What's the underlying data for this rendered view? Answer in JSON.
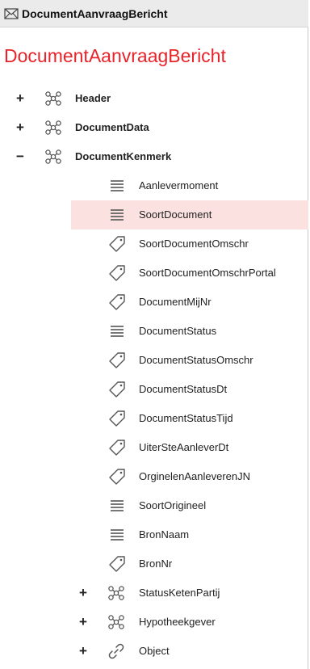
{
  "window": {
    "title": "DocumentAanvraagBericht"
  },
  "heading": "DocumentAanvraagBericht",
  "tree": {
    "top_level": [
      {
        "label": "Header",
        "expander": "+",
        "icon": "network-icon"
      },
      {
        "label": "DocumentData",
        "expander": "+",
        "icon": "network-icon"
      },
      {
        "label": "DocumentKenmerk",
        "expander": "−",
        "icon": "network-icon"
      }
    ],
    "children": [
      {
        "label": "Aanlevermoment",
        "icon": "lines-icon"
      },
      {
        "label": "SoortDocument",
        "icon": "lines-icon",
        "selected": true
      },
      {
        "label": "SoortDocumentOmschr",
        "icon": "tag-icon"
      },
      {
        "label": "SoortDocumentOmschrPortal",
        "icon": "tag-icon"
      },
      {
        "label": "DocumentMijNr",
        "icon": "tag-icon"
      },
      {
        "label": "DocumentStatus",
        "icon": "lines-icon"
      },
      {
        "label": "DocumentStatusOmschr",
        "icon": "tag-icon"
      },
      {
        "label": "DocumentStatusDt",
        "icon": "tag-icon"
      },
      {
        "label": "DocumentStatusTijd",
        "icon": "tag-icon"
      },
      {
        "label": "UiterSteAanleverDt",
        "icon": "tag-icon"
      },
      {
        "label": "OrginelenAanleverenJN",
        "icon": "tag-icon"
      },
      {
        "label": "SoortOrigineel",
        "icon": "lines-icon"
      },
      {
        "label": "BronNaam",
        "icon": "lines-icon"
      },
      {
        "label": "BronNr",
        "icon": "tag-icon"
      }
    ],
    "sub_groups": [
      {
        "label": "StatusKetenPartij",
        "expander": "+",
        "icon": "network-icon"
      },
      {
        "label": "Hypotheekgever",
        "expander": "+",
        "icon": "network-icon"
      },
      {
        "label": "Object",
        "expander": "+",
        "icon": "link-icon"
      }
    ]
  },
  "colors": {
    "heading": "#e8232a",
    "selected_row": "#fbe2e1"
  }
}
